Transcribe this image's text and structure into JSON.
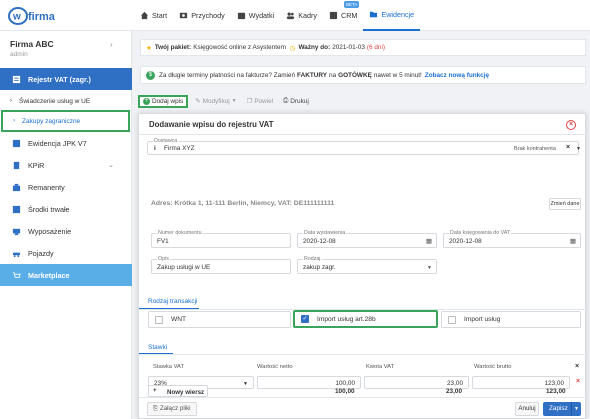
{
  "app": {
    "logo_text": "wfirma"
  },
  "nav": [
    {
      "label": "Start",
      "icon": "home-icon"
    },
    {
      "label": "Przychody",
      "icon": "money-icon"
    },
    {
      "label": "Wydatki",
      "icon": "wallet-icon"
    },
    {
      "label": "Kadry",
      "icon": "people-icon"
    },
    {
      "label": "CRM",
      "icon": "crm-icon",
      "badge": "BETA"
    },
    {
      "label": "Ewidencje",
      "icon": "folder-icon",
      "active": true
    }
  ],
  "sidebar": {
    "company": "Firma ABC",
    "user": "admin",
    "items": [
      {
        "label": "Rejestr VAT (zagr.)",
        "icon": "register-icon"
      },
      {
        "label": "Świadczenie usług w UE"
      },
      {
        "label": "Zakupy zagraniczne"
      },
      {
        "label": "Ewidencja JPK V7",
        "icon": "jpk-icon"
      },
      {
        "label": "KPiR",
        "icon": "book-icon"
      },
      {
        "label": "Remanenty",
        "icon": "inventory-icon"
      },
      {
        "label": "Środki trwałe",
        "icon": "assets-icon"
      },
      {
        "label": "Wyposażenie",
        "icon": "equipment-icon"
      },
      {
        "label": "Pojazdy",
        "icon": "car-icon"
      },
      {
        "label": "Marketplace",
        "icon": "cart-icon"
      }
    ]
  },
  "banner1": {
    "pkg_label": "Twój pakiet:",
    "pkg_value": "Księgowość online z Asystentem",
    "valid_label": "Ważny do:",
    "valid_value": "2021-01-03",
    "valid_days": "(6 dni)"
  },
  "banner2": {
    "text_a": "Za długie terminy płatności na fakturze? Zamień",
    "text_b": "FAKTURY",
    "text_c": "na",
    "text_d": "GOTÓWKĘ",
    "text_e": "nawet w 5 minut!",
    "link": "Zobacz nową funkcję"
  },
  "toolbar": {
    "add": "Dodaj wpis",
    "modify": "Modyfikuj",
    "repeat": "Powiel",
    "print": "Drukuj"
  },
  "modal": {
    "title": "Dodawanie wpisu do rejestru VAT",
    "supplier_label": "Dostawca",
    "supplier_value": "Firma XYZ",
    "supplier_status": "Brak kontrahenta",
    "address": "Adres: Krótka 1, 11-111 Berlin, Niemcy, VAT: DE111111111",
    "change_btn": "Zmień dane",
    "doc_number_label": "Numer dokumentu",
    "doc_number_value": "FV1",
    "issue_date_label": "Data wystawienia",
    "issue_date_value": "2020-12-08",
    "posting_date_label": "Data księgowania do VAT",
    "posting_date_value": "2020-12-08",
    "desc_label": "Opis",
    "desc_value": "Zakup usługi w UE",
    "type_label": "Rodzaj",
    "type_value": "zakup zagr.",
    "transaction_tab": "Rodzaj transakcji",
    "options": [
      "WNT",
      "Import usług art.28b",
      "Import usług"
    ],
    "rates_tab": "Stawki",
    "col_rate": "Stawka VAT",
    "col_net": "Wartość netto",
    "col_vat": "Kwota VAT",
    "col_gross": "Wartość brutto",
    "row_rate": "23%",
    "row_net": "100,00",
    "row_vat": "23,00",
    "row_gross": "123,00",
    "new_row": "Nowy wiersz",
    "sum_net": "100,00",
    "sum_vat": "23,00",
    "sum_gross": "123,00",
    "attach": "Załącz pliki",
    "cancel": "Anuluj",
    "save": "Zapisz"
  },
  "colors": {
    "accent": "#2f6fc4",
    "highlight": "#3aa55a",
    "marketplace": "#5aaee8"
  }
}
